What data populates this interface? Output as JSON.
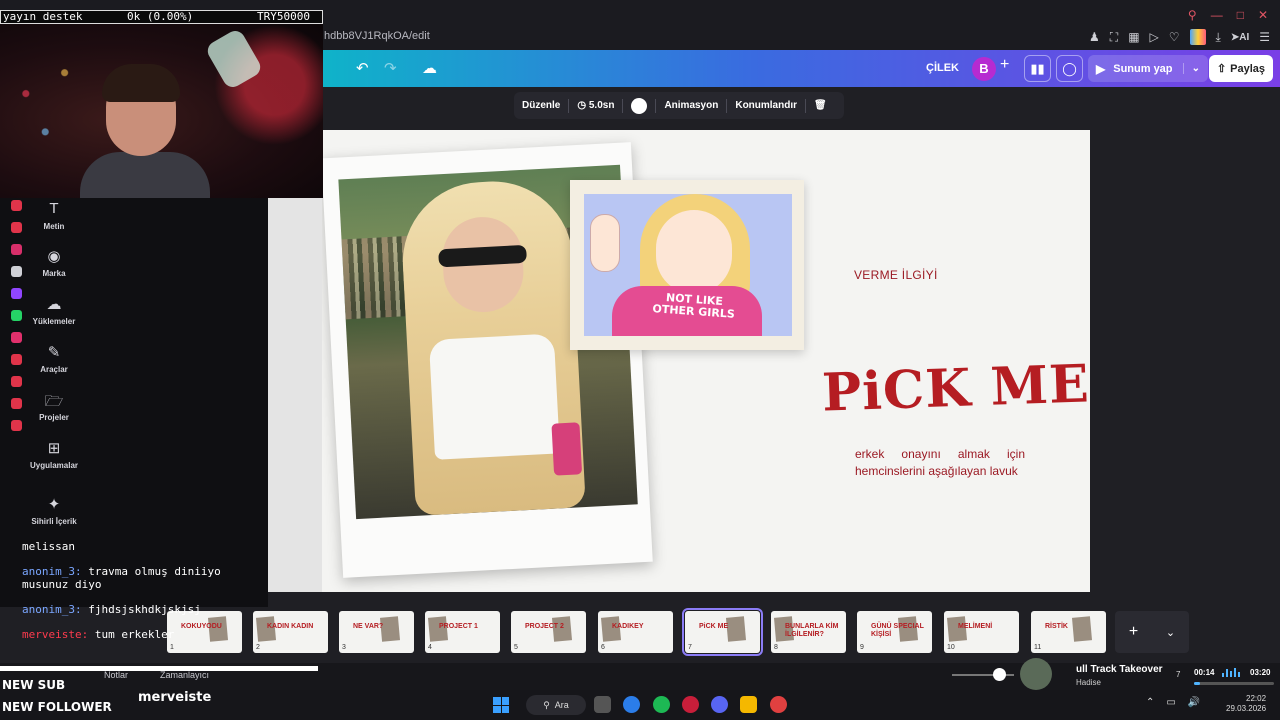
{
  "browser": {
    "url": "hdbb8VJ1RqkOA/edit"
  },
  "topbar": {
    "doc_title": "ÇİLEK",
    "avatar_letter": "B",
    "present_label": "Sunum yap",
    "share_label": "Paylaş"
  },
  "element_toolbar": {
    "edit_label": "Düzenle",
    "duration": "5.0sn",
    "animation_label": "Animasyon",
    "position_label": "Konumlandır"
  },
  "sidebar": {
    "items": [
      {
        "label": "Metin",
        "icon": "text-icon"
      },
      {
        "label": "Marka",
        "icon": "brand-icon"
      },
      {
        "label": "Yüklemeler",
        "icon": "upload-cloud-icon"
      },
      {
        "label": "Araçlar",
        "icon": "pen-tool-icon"
      },
      {
        "label": "Projeler",
        "icon": "folder-icon"
      },
      {
        "label": "Uygulamalar",
        "icon": "apps-icon"
      },
      {
        "label": "Sihirli İçerik",
        "icon": "magic-media-icon"
      }
    ]
  },
  "slide": {
    "subtitle": "VERME İLGİYİ",
    "title": "PiCK ME",
    "description": "erkek onayını almak için hemcinslerini aşağılayan lavuk",
    "cartoon_text": "NOT LIKE OTHER GIRLS"
  },
  "filmstrip": {
    "pages": [
      {
        "num": "1",
        "title": "KOKUYODU",
        "active": false
      },
      {
        "num": "2",
        "title": "KADIN KADIN",
        "active": false
      },
      {
        "num": "3",
        "title": "NE VAR?",
        "active": false
      },
      {
        "num": "4",
        "title": "PROJECT 1",
        "active": false
      },
      {
        "num": "5",
        "title": "PROJECT 2",
        "active": false
      },
      {
        "num": "6",
        "title": "KADIKEY",
        "active": false
      },
      {
        "num": "7",
        "title": "PiCK ME",
        "active": true
      },
      {
        "num": "8",
        "title": "BUNLARLA KİM İLGİLENİR?",
        "active": false
      },
      {
        "num": "9",
        "title": "GÜNÜ SPECIAL KİŞİSİ",
        "active": false
      },
      {
        "num": "10",
        "title": "MELİMENİ",
        "active": false
      },
      {
        "num": "11",
        "title": "RİSTİK",
        "active": false
      }
    ]
  },
  "bottombar": {
    "notes_label": "Notlar",
    "timer_label": "Zamanlayıcı",
    "zoom_fraction": 0.75
  },
  "music": {
    "title": "ull Track Takeover",
    "artist": "Hadise",
    "count": "7",
    "current": "00:14",
    "total": "03:20",
    "progress": 0.07
  },
  "taskbar": {
    "search_label": "Ara",
    "time": "22:02",
    "date": "29.03.2026"
  },
  "stream": {
    "donation_label": "yayın destek",
    "donation_progress": "0k (0.00%)",
    "donation_goal": "TRY50000",
    "chat": [
      {
        "user": "",
        "msg": "melissan",
        "color": "normal"
      },
      {
        "user": "anonim_3:",
        "msg": "travma olmuş diniiyo",
        "color": "normal"
      },
      {
        "user": "",
        "msg": "musunuz diyo",
        "color": "normal"
      },
      {
        "user": "anonim_3:",
        "msg": "fjhdsjskhdkjskjsj",
        "color": "normal"
      },
      {
        "user": "merveiste:",
        "msg": "tum erkekler",
        "color": "red"
      }
    ],
    "alert_sub": "NEW SUB",
    "alert_follower": "NEW FOLLOWER",
    "alert_name": "merveiste"
  },
  "colors": {
    "accent_red": "#b51d22",
    "canva_gradient_start": "#0fb3c9",
    "canva_gradient_end": "#7a3fe6",
    "active_outline": "#8b7cf6"
  }
}
